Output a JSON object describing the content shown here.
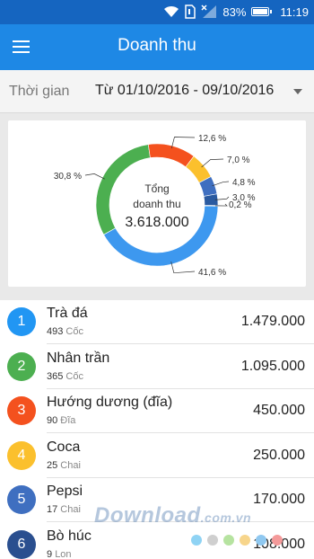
{
  "status_bar": {
    "battery": "83%",
    "time": "11:19"
  },
  "app_bar": {
    "title": "Doanh thu"
  },
  "filter": {
    "label": "Thời gian",
    "value": "Từ 01/10/2016 - 09/10/2016"
  },
  "colors": {
    "status_bar": "#1565c0",
    "app_bar": "#1e88e5"
  },
  "chart_data": {
    "type": "pie",
    "center_label_line1": "Tổng",
    "center_label_line2": "doanh thu",
    "total": "3.618.000",
    "slices": [
      {
        "label": "41,6 %",
        "value": 41.6,
        "color": "#3d98ef"
      },
      {
        "label": "30,8 %",
        "value": 30.8,
        "color": "#4caf50"
      },
      {
        "label": "12,6 %",
        "value": 12.6,
        "color": "#f4511e"
      },
      {
        "label": "7,0 %",
        "value": 7.0,
        "color": "#fbc02d"
      },
      {
        "label": "4,8 %",
        "value": 4.8,
        "color": "#3f6fc0"
      },
      {
        "label": "3,0 %",
        "value": 3.0,
        "color": "#2a5aa0"
      },
      {
        "label": "0,2 %",
        "value": 0.2,
        "color": "#1e3f7a"
      }
    ]
  },
  "items": [
    {
      "rank": "1",
      "name": "Trà đá",
      "qty": "493",
      "unit": "Cốc",
      "amount": "1.479.000",
      "color": "#2196f3"
    },
    {
      "rank": "2",
      "name": "Nhân trần",
      "qty": "365",
      "unit": "Cốc",
      "amount": "1.095.000",
      "color": "#4caf50"
    },
    {
      "rank": "3",
      "name": "Hướng dương (đĩa)",
      "qty": "90",
      "unit": "Đĩa",
      "amount": "450.000",
      "color": "#f4511e"
    },
    {
      "rank": "4",
      "name": "Coca",
      "qty": "25",
      "unit": "Chai",
      "amount": "250.000",
      "color": "#fbc02d"
    },
    {
      "rank": "5",
      "name": "Pepsi",
      "qty": "17",
      "unit": "Chai",
      "amount": "170.000",
      "color": "#3f6fc0"
    },
    {
      "rank": "6",
      "name": "Bò húc",
      "qty": "9",
      "unit": "Lon",
      "amount": "108.000",
      "color": "#2a4f8f"
    }
  ],
  "watermark": {
    "main": "Download",
    "suffix": ".com.vn"
  }
}
